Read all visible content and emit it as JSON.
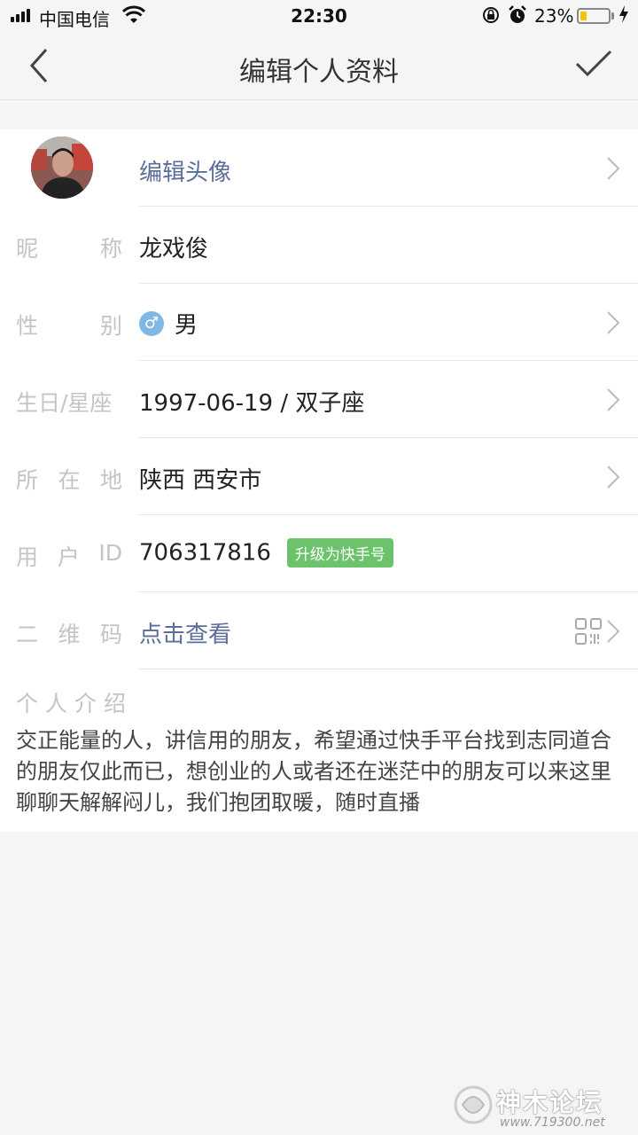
{
  "status_bar": {
    "carrier": "中国电信",
    "time": "22:30",
    "battery_percent_text": "23%",
    "battery_level": 0.23
  },
  "nav": {
    "title": "编辑个人资料"
  },
  "profile": {
    "avatar_action": "编辑头像",
    "nickname": {
      "label_chars": [
        "昵",
        "称"
      ],
      "value": "龙戏俊"
    },
    "gender": {
      "label_chars": [
        "性",
        "别"
      ],
      "icon_glyph": "♂",
      "value": "男"
    },
    "birthday": {
      "label": "生日/星座",
      "value": "1997-06-19 / 双子座"
    },
    "location": {
      "label_chars": [
        "所",
        "在",
        "地"
      ],
      "value": "陕西 西安市"
    },
    "user_id": {
      "label_chars": [
        "用",
        "户",
        "ID"
      ],
      "value": "706317816",
      "badge": "升级为快手号"
    },
    "qrcode": {
      "label_chars": [
        "二",
        "维",
        "码"
      ],
      "value": "点击查看"
    },
    "intro": {
      "label": "个人介绍",
      "text": "交正能量的人，讲信用的朋友，希望通过快手平台找到志同道合的朋友仅此而已，想创业的人或者还在迷茫中的朋友可以来这里聊聊天解解闷儿，我们抱团取暖，随时直播"
    }
  },
  "watermark": {
    "text": "神木论坛",
    "url": "www.719300.net"
  },
  "colors": {
    "link": "#5a6e99",
    "badge": "#6cc36c",
    "gender_icon": "#7fb8e3",
    "battery_fill": "#f5c400"
  }
}
